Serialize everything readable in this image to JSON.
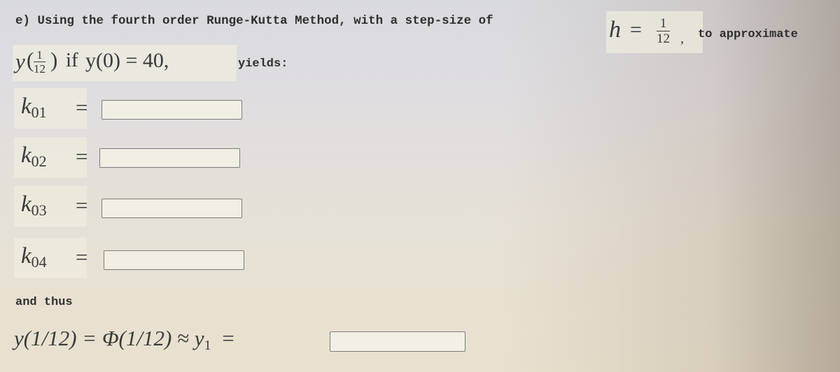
{
  "problem": {
    "part_label": "e)",
    "intro_text": "Using the fourth order Runge-Kutta Method, with a step-size of",
    "step_size": {
      "variable": "h",
      "equals": "=",
      "numerator": "1",
      "denominator": "12",
      "trailing": ","
    },
    "to_approximate": "to approximate",
    "target": {
      "func": "y",
      "arg_numerator": "1",
      "arg_denominator": "12",
      "condition_word": "if",
      "initial_condition": "y(0) = 40,",
      "yields": "yields:"
    }
  },
  "k_values": [
    {
      "symbol": "k",
      "subscript": "01",
      "equals": "=",
      "value": ""
    },
    {
      "symbol": "k",
      "subscript": "02",
      "equals": "=",
      "value": ""
    },
    {
      "symbol": "k",
      "subscript": "03",
      "equals": "=",
      "value": ""
    },
    {
      "symbol": "k",
      "subscript": "04",
      "equals": "=",
      "value": ""
    }
  ],
  "conclusion": {
    "and_thus": "and thus",
    "lhs": "y(1/12) = Φ(1/12) ≈ y",
    "subscript": "1",
    "equals": "=",
    "answer_value": ""
  }
}
